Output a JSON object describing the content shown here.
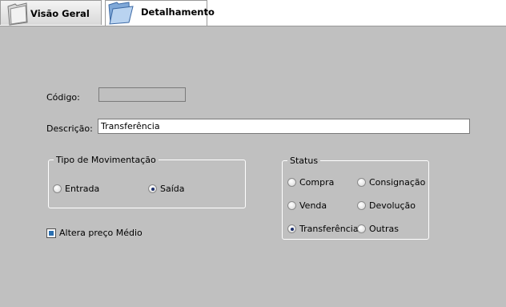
{
  "tabs": {
    "overview_label": "Visão Geral",
    "detail_label": "Detalhamento"
  },
  "form": {
    "code_label": "Código:",
    "code_value": "",
    "description_label": "Descrição:",
    "description_value": "Transferência"
  },
  "movement_type": {
    "legend": "Tipo de Movimentação",
    "options": [
      {
        "label": "Entrada",
        "selected": false
      },
      {
        "label": "Saída",
        "selected": true
      }
    ]
  },
  "status": {
    "legend": "Status",
    "options": [
      {
        "label": "Compra",
        "selected": false
      },
      {
        "label": "Consignação",
        "selected": false
      },
      {
        "label": "Venda",
        "selected": false
      },
      {
        "label": "Devolução",
        "selected": false
      },
      {
        "label": "Transferência",
        "selected": true
      },
      {
        "label": "Outras",
        "selected": false
      }
    ]
  },
  "average_price": {
    "label": "Altera preço Médio",
    "checked": true
  },
  "colors": {
    "panel_bg": "#c0c0c0",
    "radio_dot": "#1c2f6e",
    "checkbox_fill": "#2a6fb0"
  }
}
